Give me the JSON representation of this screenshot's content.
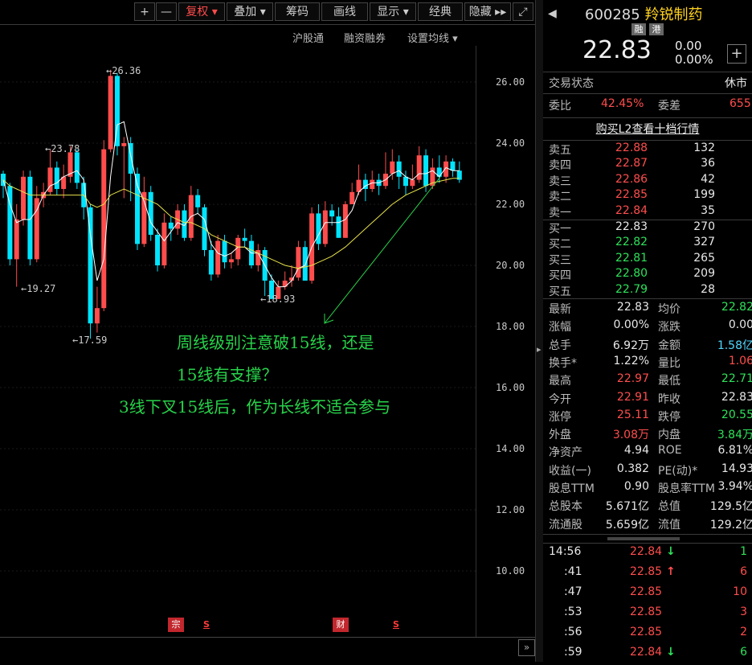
{
  "toolbar": {
    "items": [
      {
        "label": "+",
        "id": "zoom-in"
      },
      {
        "label": "—",
        "id": "zoom-out"
      },
      {
        "label": "复权 ▾",
        "id": "fuquan"
      },
      {
        "label": "叠加 ▾",
        "id": "diejia"
      },
      {
        "label": "筹码",
        "id": "chouma"
      },
      {
        "label": "画线",
        "id": "huaxian"
      },
      {
        "label": "显示 ▾",
        "id": "xianshi"
      },
      {
        "label": "经典",
        "id": "jingdian"
      },
      {
        "label": "隐藏 ▸▸",
        "id": "yincang"
      },
      {
        "label": "⤢",
        "id": "fullscreen"
      }
    ]
  },
  "subbar": {
    "hugutong": "沪股通",
    "rongzi": "融资融券",
    "junxian": "设置均线 ▾"
  },
  "axis": {
    "ticks": [
      "26.00",
      "24.00",
      "22.00",
      "20.00",
      "18.00",
      "16.00",
      "14.00",
      "12.00",
      "10.00"
    ]
  },
  "price_labels": {
    "high": "26.36",
    "p2378": "23.78",
    "p1927": "19.27",
    "low": "17.59",
    "p1893": "18.93"
  },
  "annotation": {
    "line1": "周线级别注意破15线，还是",
    "line2": "15线有支撑？",
    "line3": "3线下叉15线后，作为长线不适合参与"
  },
  "markers": {
    "zong": "宗",
    "s1": "S",
    "cai": "财",
    "s2": "S"
  },
  "colors": {
    "up": "#ff4d4d",
    "down": "#00e5ff",
    "ma_fast": "#ffffff",
    "ma_slow": "#e8e24a",
    "annotation": "#27d34a"
  },
  "stock": {
    "code": "600285",
    "name": "羚锐制药",
    "tag1": "融",
    "tag2": "港",
    "price": "22.83",
    "change": "0.00",
    "change_pct": "0.00%"
  },
  "status": {
    "label": "交易状态",
    "value": "休市"
  },
  "weibi": {
    "label1": "委比",
    "value1": "42.45%",
    "label2": "委差",
    "value2": "655"
  },
  "l2_link": "购买L2查看十档行情",
  "asks": [
    {
      "label": "卖五",
      "price": "22.88",
      "vol": "132"
    },
    {
      "label": "卖四",
      "price": "22.87",
      "vol": "36"
    },
    {
      "label": "卖三",
      "price": "22.86",
      "vol": "42"
    },
    {
      "label": "卖二",
      "price": "22.85",
      "vol": "199"
    },
    {
      "label": "卖一",
      "price": "22.84",
      "vol": "35"
    }
  ],
  "bids": [
    {
      "label": "买一",
      "price": "22.83",
      "vol": "270"
    },
    {
      "label": "买二",
      "price": "22.82",
      "vol": "327"
    },
    {
      "label": "买三",
      "price": "22.81",
      "vol": "265"
    },
    {
      "label": "买四",
      "price": "22.80",
      "vol": "209"
    },
    {
      "label": "买五",
      "price": "22.79",
      "vol": "28"
    }
  ],
  "stats": [
    {
      "l1": "最新",
      "v1": "22.83",
      "c1": "white",
      "l2": "均价",
      "v2": "22.82",
      "c2": "green"
    },
    {
      "l1": "涨幅",
      "v1": "0.00%",
      "c1": "white",
      "l2": "涨跌",
      "v2": "0.00",
      "c2": "white"
    },
    {
      "l1": "总手",
      "v1": "6.92万",
      "c1": "white",
      "l2": "金额",
      "v2": "1.58亿",
      "c2": "cyan"
    },
    {
      "l1": "换手*",
      "v1": "1.22%",
      "c1": "white",
      "l2": "量比",
      "v2": "1.06",
      "c2": "red"
    },
    {
      "l1": "最高",
      "v1": "22.97",
      "c1": "red",
      "l2": "最低",
      "v2": "22.71",
      "c2": "green"
    },
    {
      "l1": "今开",
      "v1": "22.91",
      "c1": "red",
      "l2": "昨收",
      "v2": "22.83",
      "c2": "white"
    },
    {
      "l1": "涨停",
      "v1": "25.11",
      "c1": "red",
      "l2": "跌停",
      "v2": "20.55",
      "c2": "green"
    },
    {
      "l1": "外盘",
      "v1": "3.08万",
      "c1": "red",
      "l2": "内盘",
      "v2": "3.84万",
      "c2": "green"
    },
    {
      "l1": "净资产",
      "v1": "4.94",
      "c1": "white",
      "l2": "ROE",
      "v2": "6.81%",
      "c2": "white"
    },
    {
      "l1": "收益(一)",
      "v1": "0.382",
      "c1": "white",
      "l2": "PE(动)*",
      "v2": "14.93",
      "c2": "white"
    },
    {
      "l1": "股息TTM",
      "v1": "0.90",
      "c1": "white",
      "l2": "股息率TTM",
      "v2": "3.94%",
      "c2": "white"
    },
    {
      "l1": "总股本",
      "v1": "5.671亿",
      "c1": "white",
      "l2": "总值",
      "v2": "129.5亿",
      "c2": "white"
    },
    {
      "l1": "流通股",
      "v1": "5.659亿",
      "c1": "white",
      "l2": "流值",
      "v2": "129.2亿",
      "c2": "white"
    }
  ],
  "ticks": [
    {
      "time": "14:56",
      "price": "22.84",
      "arrow": "↓",
      "arrow_color": "green",
      "vol": "1",
      "vol_color": "green"
    },
    {
      "time": ":41",
      "price": "22.85",
      "arrow": "↑",
      "arrow_color": "red",
      "vol": "6",
      "vol_color": "red"
    },
    {
      "time": ":47",
      "price": "22.85",
      "arrow": "",
      "arrow_color": "white",
      "vol": "10",
      "vol_color": "red"
    },
    {
      "time": ":53",
      "price": "22.85",
      "arrow": "",
      "arrow_color": "white",
      "vol": "3",
      "vol_color": "red"
    },
    {
      "time": ":56",
      "price": "22.85",
      "arrow": "",
      "arrow_color": "white",
      "vol": "2",
      "vol_color": "red"
    },
    {
      "time": ":59",
      "price": "22.84",
      "arrow": "↓",
      "arrow_color": "green",
      "vol": "6",
      "vol_color": "green"
    }
  ],
  "chart_data": {
    "type": "candlestick",
    "y_range": [
      9.0,
      27.3
    ],
    "candles": [
      [
        23.0,
        22.6,
        23.1,
        22.2
      ],
      [
        22.6,
        20.2,
        22.7,
        20.0
      ],
      [
        20.2,
        21.5,
        22.0,
        19.3
      ],
      [
        21.5,
        22.9,
        23.1,
        21.3
      ],
      [
        22.9,
        20.2,
        23.1,
        20.0
      ],
      [
        20.2,
        22.2,
        22.6,
        20.1
      ],
      [
        22.2,
        22.4,
        22.7,
        21.9
      ],
      [
        22.4,
        23.2,
        23.8,
        22.3
      ],
      [
        23.2,
        22.5,
        23.4,
        22.3
      ],
      [
        22.5,
        22.9,
        23.3,
        22.2
      ],
      [
        22.9,
        23.7,
        23.9,
        22.7
      ],
      [
        23.7,
        22.7,
        23.8,
        22.5
      ],
      [
        22.7,
        21.9,
        22.9,
        21.5
      ],
      [
        21.9,
        18.1,
        22.0,
        17.6
      ],
      [
        18.1,
        18.6,
        19.3,
        17.8
      ],
      [
        18.6,
        23.8,
        24.1,
        18.5
      ],
      [
        23.8,
        26.2,
        26.4,
        23.7
      ],
      [
        26.2,
        23.9,
        26.3,
        23.6
      ],
      [
        23.9,
        24.0,
        24.2,
        22.2
      ],
      [
        24.0,
        23.0,
        24.2,
        22.1
      ],
      [
        23.0,
        20.7,
        23.2,
        20.5
      ],
      [
        20.7,
        22.4,
        22.9,
        20.6
      ],
      [
        22.4,
        21.0,
        22.6,
        20.8
      ],
      [
        21.0,
        20.0,
        21.2,
        19.8
      ],
      [
        20.0,
        21.4,
        21.7,
        19.9
      ],
      [
        21.4,
        21.2,
        21.6,
        20.8
      ],
      [
        21.2,
        21.8,
        22.0,
        21.0
      ],
      [
        21.8,
        20.9,
        22.0,
        20.8
      ],
      [
        20.9,
        22.3,
        22.6,
        20.8
      ],
      [
        22.3,
        21.9,
        22.5,
        21.7
      ],
      [
        21.9,
        20.5,
        22.0,
        20.3
      ],
      [
        20.5,
        19.7,
        20.8,
        19.5
      ],
      [
        19.7,
        20.8,
        21.0,
        19.6
      ],
      [
        20.8,
        20.1,
        21.0,
        19.9
      ],
      [
        20.1,
        20.2,
        20.4,
        19.9
      ],
      [
        20.2,
        20.9,
        21.0,
        20.0
      ],
      [
        20.9,
        20.8,
        21.2,
        20.6
      ],
      [
        20.8,
        20.0,
        21.0,
        19.9
      ],
      [
        20.0,
        20.5,
        20.7,
        19.8
      ],
      [
        20.5,
        19.5,
        20.6,
        19.0
      ],
      [
        19.5,
        18.9,
        19.7,
        18.9
      ],
      [
        18.9,
        19.3,
        19.5,
        18.9
      ],
      [
        19.3,
        19.5,
        19.8,
        19.2
      ],
      [
        19.5,
        19.6,
        20.0,
        19.3
      ],
      [
        19.6,
        20.6,
        20.8,
        19.5
      ],
      [
        20.6,
        19.5,
        20.8,
        19.5
      ],
      [
        19.5,
        21.7,
        21.9,
        19.4
      ],
      [
        21.7,
        20.7,
        22.0,
        20.5
      ],
      [
        20.7,
        21.8,
        22.1,
        20.6
      ],
      [
        21.8,
        21.6,
        22.0,
        21.3
      ],
      [
        21.6,
        20.9,
        21.9,
        20.9
      ],
      [
        20.9,
        22.0,
        22.1,
        20.9
      ],
      [
        22.0,
        22.4,
        22.7,
        22.0
      ],
      [
        22.4,
        22.8,
        23.3,
        22.3
      ],
      [
        22.8,
        22.5,
        23.0,
        22.1
      ],
      [
        22.5,
        22.8,
        23.1,
        22.4
      ],
      [
        22.8,
        22.6,
        23.0,
        22.3
      ],
      [
        22.6,
        23.0,
        23.7,
        22.5
      ],
      [
        23.0,
        23.4,
        23.8,
        22.8
      ],
      [
        23.4,
        22.9,
        23.6,
        22.5
      ],
      [
        22.9,
        22.6,
        23.1,
        22.3
      ],
      [
        22.6,
        22.8,
        23.3,
        22.5
      ],
      [
        22.8,
        23.6,
        23.9,
        22.7
      ],
      [
        23.6,
        22.6,
        23.8,
        22.4
      ],
      [
        22.6,
        23.2,
        23.5,
        22.5
      ],
      [
        23.2,
        22.9,
        23.6,
        22.7
      ],
      [
        22.9,
        23.4,
        23.6,
        22.7
      ],
      [
        23.4,
        23.1,
        23.5,
        22.9
      ],
      [
        23.1,
        22.8,
        23.4,
        22.7
      ]
    ],
    "ma3": [
      22.8,
      22.0,
      21.4,
      21.5,
      21.5,
      21.8,
      22.3,
      22.6,
      22.7,
      22.9,
      23.0,
      23.1,
      22.8,
      21.0,
      19.5,
      20.2,
      22.9,
      24.6,
      24.7,
      23.6,
      22.6,
      22.1,
      21.4,
      21.1,
      20.8,
      21.1,
      21.4,
      21.3,
      21.6,
      21.7,
      21.5,
      20.7,
      20.4,
      20.3,
      20.4,
      20.6,
      20.6,
      20.4,
      20.4,
      20.0,
      19.6,
      19.3,
      19.3,
      19.5,
      19.9,
      20.0,
      20.6,
      21.0,
      21.4,
      21.4,
      21.4,
      21.5,
      21.8,
      22.4,
      22.6,
      22.7,
      22.7,
      22.8,
      23.0,
      23.1,
      22.9,
      22.8,
      23.0,
      23.0,
      23.1,
      22.9,
      23.2,
      23.1,
      23.1
    ],
    "ma15": [
      22.8,
      22.6,
      22.5,
      22.4,
      22.3,
      22.3,
      22.3,
      22.3,
      22.3,
      22.3,
      22.3,
      22.3,
      22.3,
      22.0,
      21.9,
      22.0,
      22.3,
      22.4,
      22.5,
      22.4,
      22.3,
      22.2,
      22.1,
      22.0,
      21.8,
      21.6,
      21.5,
      21.4,
      21.4,
      21.3,
      21.2,
      21.0,
      20.9,
      20.8,
      20.7,
      20.6,
      20.6,
      20.5,
      20.4,
      20.3,
      20.2,
      20.1,
      20.0,
      19.95,
      19.9,
      19.95,
      20.0,
      20.1,
      20.2,
      20.3,
      20.45,
      20.6,
      20.8,
      21.0,
      21.2,
      21.4,
      21.6,
      21.8,
      22.0,
      22.15,
      22.3,
      22.4,
      22.5,
      22.6,
      22.7,
      22.75,
      22.8,
      22.85,
      22.85
    ]
  }
}
